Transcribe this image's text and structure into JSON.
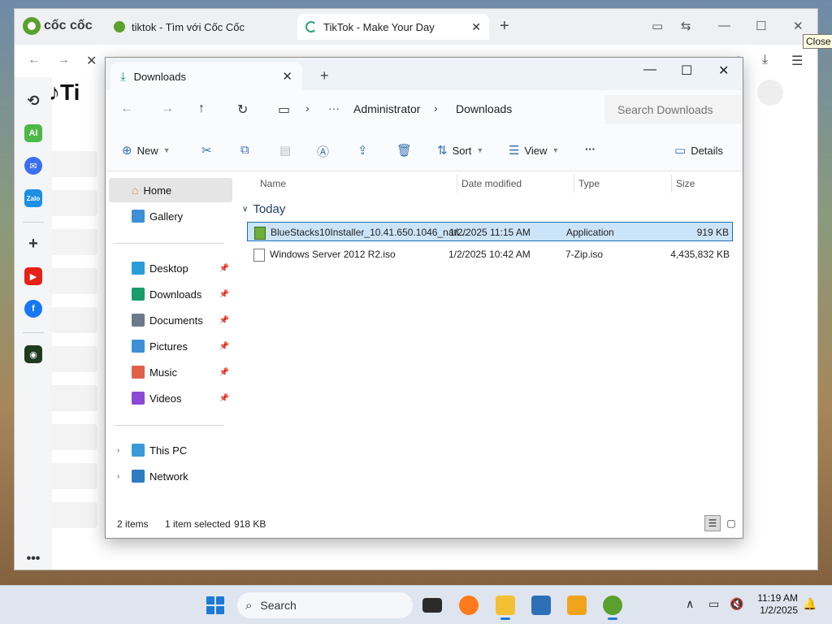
{
  "browser": {
    "brand": "cốc cốc",
    "tabs": [
      {
        "title": "tiktok - Tìm với Cốc Cốc"
      },
      {
        "title": "TikTok - Make Your Day"
      }
    ],
    "close_tooltip": "Close",
    "page_logo_text": "Ti"
  },
  "explorer": {
    "tab_title": "Downloads",
    "breadcrumb": [
      "Administrator",
      "Downloads"
    ],
    "search_placeholder": "Search Downloads",
    "commands": {
      "new": "New",
      "sort": "Sort",
      "view": "View",
      "details": "Details"
    },
    "nav": {
      "home": "Home",
      "gallery": "Gallery",
      "pinned": [
        {
          "label": "Desktop",
          "icon": "desktop-icon",
          "color": "#2b9bd9"
        },
        {
          "label": "Downloads",
          "icon": "download-icon",
          "color": "#1a9b6c"
        },
        {
          "label": "Documents",
          "icon": "document-icon",
          "color": "#6b7b8c"
        },
        {
          "label": "Pictures",
          "icon": "picture-icon",
          "color": "#3d8fd6"
        },
        {
          "label": "Music",
          "icon": "music-icon",
          "color": "#e0604a"
        },
        {
          "label": "Videos",
          "icon": "video-icon",
          "color": "#8b4ad6"
        }
      ],
      "this_pc": "This PC",
      "network": "Network"
    },
    "columns": [
      "Name",
      "Date modified",
      "Type",
      "Size"
    ],
    "group": "Today",
    "files": [
      {
        "name": "BlueStacks10Installer_10.41.650.1046_nati...",
        "date": "1/2/2025 11:15 AM",
        "type": "Application",
        "size": "919 KB",
        "selected": true
      },
      {
        "name": "Windows Server 2012 R2.iso",
        "date": "1/2/2025 10:42 AM",
        "type": "7-Zip.iso",
        "size": "4,435,832 KB",
        "selected": false
      }
    ],
    "status": {
      "items": "2 items",
      "selected": "1 item selected",
      "size": "918 KB"
    }
  },
  "taskbar": {
    "search_label": "Search",
    "time": "11:19 AM",
    "date": "1/2/2025"
  }
}
